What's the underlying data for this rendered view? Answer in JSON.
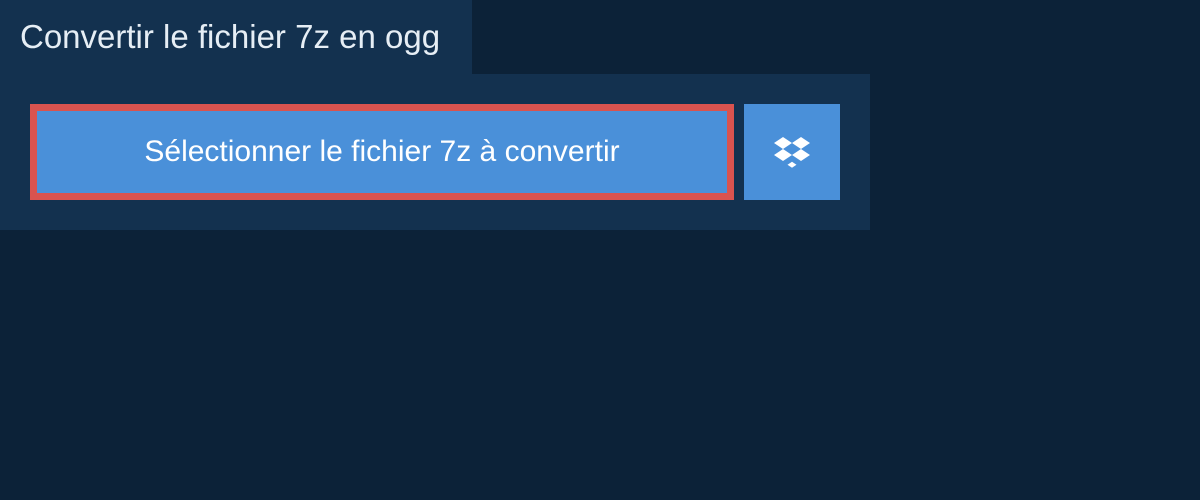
{
  "header": {
    "title": "Convertir le fichier 7z en ogg"
  },
  "buttons": {
    "select_label": "Sélectionner le fichier 7z à convertir"
  },
  "colors": {
    "background": "#0c2238",
    "panel": "#13314f",
    "button_bg": "#4a90d9",
    "highlight_border": "#d9534f",
    "text_light": "#e6eef5",
    "text_white": "#ffffff"
  }
}
